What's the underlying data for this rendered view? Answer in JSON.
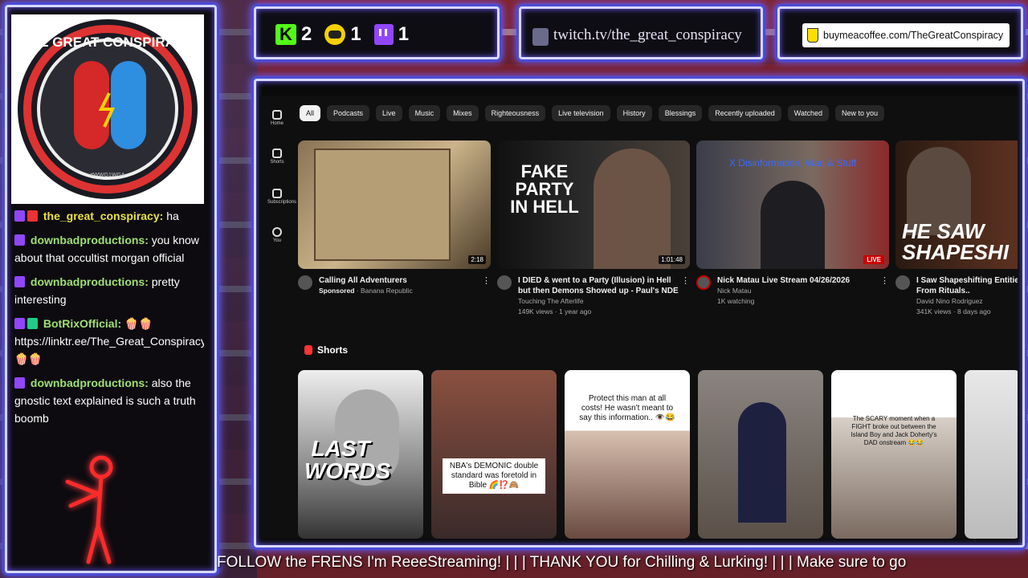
{
  "logo": {
    "text": "THE GREAT CONSPIRACY",
    "sub": "#WWG1WGA"
  },
  "stats": {
    "kick": "2",
    "rumble": "1",
    "twitch": "1"
  },
  "twitch_url": "twitch.tv/the_great_conspiracy",
  "coffee_url": "buymeacoffee.com/TheGreatConspiracy",
  "chat": [
    {
      "user": "the_great_conspiracy:",
      "text": "ha"
    },
    {
      "user": "downbadproductions:",
      "text": "you know about that occultist morgan official"
    },
    {
      "user": "downbadproductions:",
      "text": "pretty interesting"
    },
    {
      "user": "BotRixOfficial:",
      "text": "🍿🍿 https://linktr.ee/The_Great_Conspiracy 🍿🍿"
    },
    {
      "user": "downbadproductions:",
      "text": "also the gnostic text explained is such a truth boomb"
    }
  ],
  "yt": {
    "side": [
      "Home",
      "Shorts",
      "Subscriptions",
      "You"
    ],
    "chips": [
      "All",
      "Podcasts",
      "Live",
      "Music",
      "Mixes",
      "Righteousness",
      "Live television",
      "History",
      "Blessings",
      "Recently uploaded",
      "Watched",
      "New to you"
    ],
    "videos": [
      {
        "title": "Calling All Adventurers",
        "channel": "Sponsored",
        "meta": "Banana Republic",
        "duration": "2:18",
        "thumb_text": ""
      },
      {
        "title": "I DIED & went to a Party (Illusion) in Hell but then Demons Showed up - Paul's NDE Miracle ...",
        "channel": "Touching The Afterlife",
        "meta": "149K views · 1 year ago",
        "duration": "1:01:48",
        "thumb_text": "FAKE PARTY IN HELL"
      },
      {
        "title": "Nick Matau Live Stream 04/26/2026",
        "channel": "Nick Matau",
        "meta": "1K watching",
        "duration": "LIVE",
        "thumb_text": "X Disinformation, War, & Stuff"
      },
      {
        "title": "I Saw Shapeshifting Entities W... Children From Rituals..",
        "channel": "David Nino Rodriguez",
        "meta": "341K views · 8 days ago",
        "duration": "",
        "thumb_text": "HE SAW SHAPESHI"
      }
    ],
    "shorts_label": "Shorts",
    "shorts": [
      {
        "caption": "LAST WORDS"
      },
      {
        "caption": "NBA's DEMONIC double standard was foretold in Bible 🌈⁉️🙈"
      },
      {
        "caption": "Protect this man at all costs! He wasn't meant to say this information.. 👁️😂"
      },
      {
        "caption": ""
      },
      {
        "caption": "The SCARY moment when a FIGHT broke out between the Island Boy and Jack Doherty's DAD onstream 😂😂"
      },
      {
        "caption": ""
      }
    ]
  },
  "ticker": "FOLLOW the FRENS I'm ReeeStreaming!   |   |   |   THANK YOU for Chilling & Lurking!   |   |   |   Make sure to go"
}
